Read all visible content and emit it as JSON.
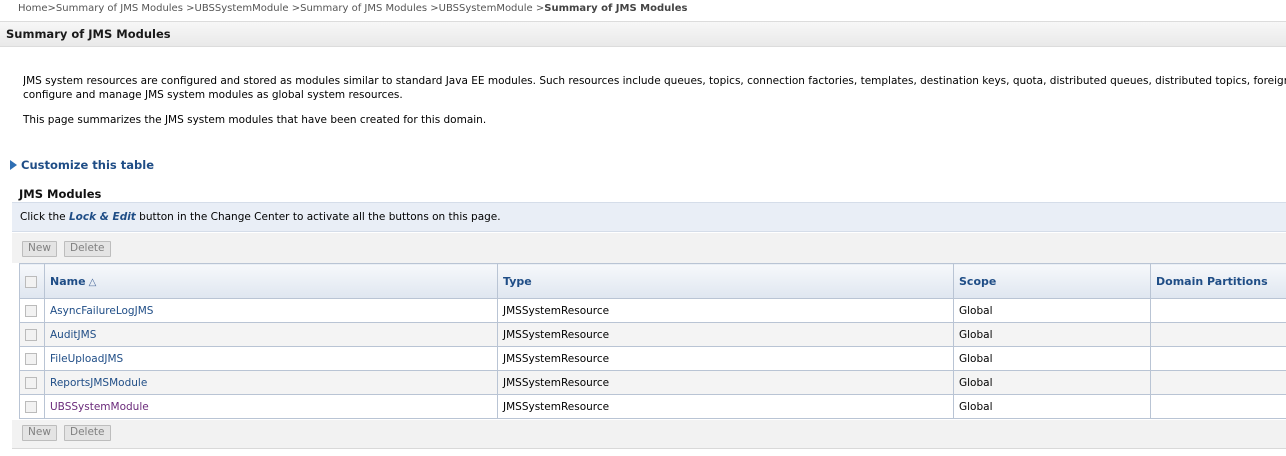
{
  "breadcrumb": {
    "items": [
      "Home",
      "Summary of JMS Modules",
      "UBSSystemModule",
      "Summary of JMS Modules",
      "UBSSystemModule"
    ],
    "separator": ">",
    "current": "Summary of JMS Modules"
  },
  "page": {
    "title": "Summary of JMS Modules",
    "description_line1": "JMS system resources are configured and stored as modules similar to standard Java EE modules. Such resources include queues, topics, connection factories, templates, destination keys, quota, distributed queues, distributed topics, foreign servers, and JMS store-and-forward (SAF) parameters. You can administratively",
    "description_line2": "configure and manage JMS system modules as global system resources.",
    "description_para2": "This page summarizes the JMS system modules that have been created for this domain."
  },
  "customize": {
    "label": "Customize this table"
  },
  "section": {
    "title": "JMS Modules",
    "hint_prefix": "Click the ",
    "hint_emphasis": "Lock & Edit",
    "hint_suffix": " button in the Change Center to activate all the buttons on this page."
  },
  "toolbar": {
    "new_label": "New",
    "delete_label": "Delete"
  },
  "table": {
    "headers": {
      "name": "Name",
      "type": "Type",
      "scope": "Scope",
      "partitions": "Domain Partitions"
    },
    "rows": [
      {
        "name": "AsyncFailureLogJMS",
        "type": "JMSSystemResource",
        "scope": "Global",
        "partitions": ""
      },
      {
        "name": "AuditJMS",
        "type": "JMSSystemResource",
        "scope": "Global",
        "partitions": ""
      },
      {
        "name": "FileUploadJMS",
        "type": "JMSSystemResource",
        "scope": "Global",
        "partitions": ""
      },
      {
        "name": "ReportsJMSModule",
        "type": "JMSSystemResource",
        "scope": "Global",
        "partitions": ""
      },
      {
        "name": "UBSSystemModule",
        "type": "JMSSystemResource",
        "scope": "Global",
        "partitions": ""
      }
    ]
  },
  "icons": {
    "sort": "sort-ascending-icon",
    "expand": "triangle-right-icon"
  },
  "colors": {
    "link": "#1f4d86",
    "header_bg": "#dfe6f0",
    "hint_bg": "#e9eef6"
  }
}
